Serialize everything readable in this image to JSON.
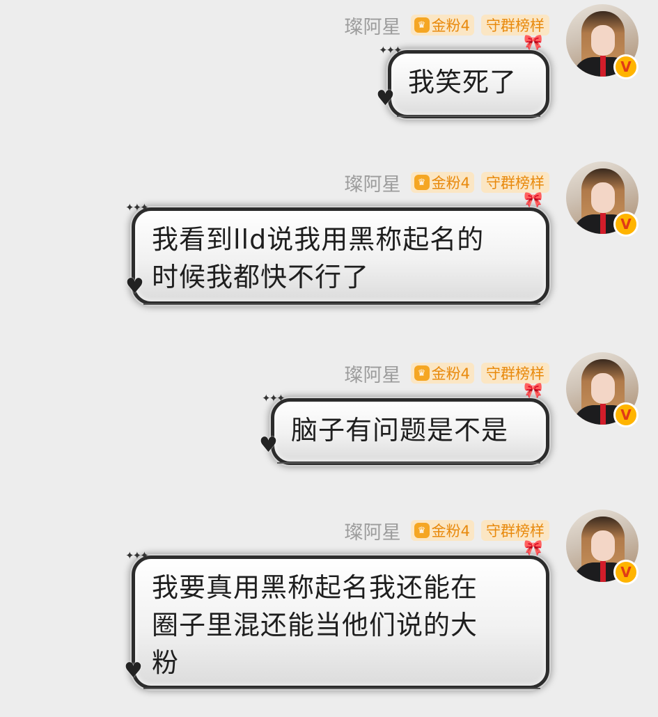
{
  "messages": [
    {
      "sender": "璨阿星",
      "tag_fan": "金粉4",
      "tag_role": "守群榜样",
      "avatar_badge": "V",
      "text": "我笑死了"
    },
    {
      "sender": "璨阿星",
      "tag_fan": "金粉4",
      "tag_role": "守群榜样",
      "avatar_badge": "V",
      "text": "我看到lld说我用黑称起名的\n时候我都快不行了"
    },
    {
      "sender": "璨阿星",
      "tag_fan": "金粉4",
      "tag_role": "守群榜样",
      "avatar_badge": "V",
      "text": "脑子有问题是不是"
    },
    {
      "sender": "璨阿星",
      "tag_fan": "金粉4",
      "tag_role": "守群榜样",
      "avatar_badge": "V",
      "text": "我要真用黑称起名我还能在\n圈子里混还能当他们说的大\n粉"
    }
  ],
  "icons": {
    "fan_badge": "crown-pentagon-icon",
    "decoration_sparkle": "sparkle-icon",
    "decoration_heart": "heart-icon",
    "decoration_bow": "bow-icon",
    "verified": "verified-v-icon"
  },
  "colors": {
    "background": "#ededed",
    "tag_bg": "#fbe6c4",
    "tag_text": "#e8890c",
    "nickname": "#9c9c9c",
    "bubble_border": "#2c2c2c",
    "badge_gold": "#ffb400",
    "badge_v": "#e03b16"
  }
}
